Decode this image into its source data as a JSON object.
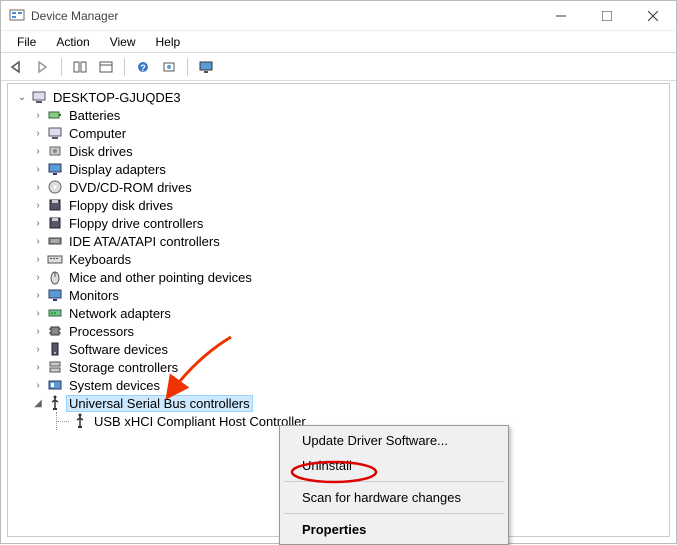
{
  "window": {
    "title": "Device Manager"
  },
  "menubar": {
    "file": "File",
    "action": "Action",
    "view": "View",
    "help": "Help"
  },
  "tree": {
    "root": "DESKTOP-GJUQDE3",
    "categories": [
      "Batteries",
      "Computer",
      "Disk drives",
      "Display adapters",
      "DVD/CD-ROM drives",
      "Floppy disk drives",
      "Floppy drive controllers",
      "IDE ATA/ATAPI controllers",
      "Keyboards",
      "Mice and other pointing devices",
      "Monitors",
      "Network adapters",
      "Processors",
      "Software devices",
      "Storage controllers",
      "System devices",
      "Universal Serial Bus controllers"
    ],
    "usb_child": "USB xHCI Compliant Host Controller"
  },
  "context_menu": {
    "update": "Update Driver Software...",
    "uninstall": "Uninstall",
    "scan": "Scan for hardware changes",
    "properties": "Properties"
  }
}
